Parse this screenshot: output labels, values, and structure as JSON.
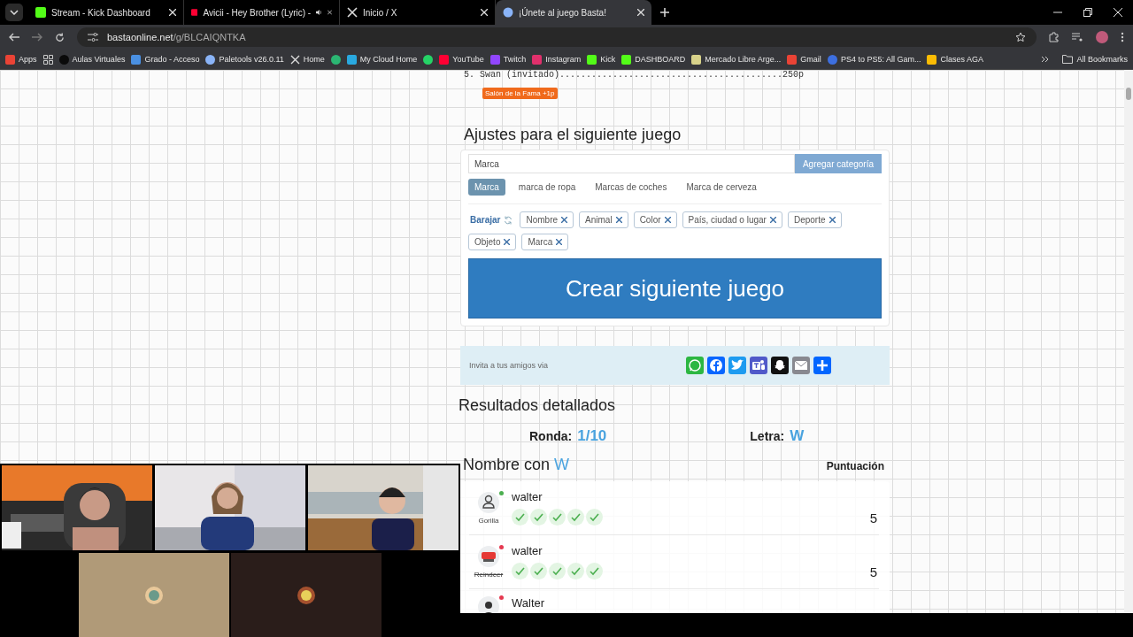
{
  "browser": {
    "tabs": [
      {
        "title": "Stream - Kick Dashboard",
        "kind": "kick",
        "selected": false,
        "audio": false
      },
      {
        "title": "Avicii - Hey Brother (Lyric) -",
        "kind": "youtube",
        "selected": false,
        "audio": true
      },
      {
        "title": "Inicio / X",
        "kind": "x",
        "selected": false,
        "audio": false
      },
      {
        "title": "¡Únete al juego Basta!",
        "kind": "globe",
        "selected": true,
        "audio": false
      }
    ],
    "url_host": "bastaonline.net",
    "url_path": "/g/BLCAIQNTKA",
    "bookmarks": [
      {
        "label": "Apps",
        "kind": "apps"
      },
      {
        "kind": "grid"
      },
      {
        "label": "Aulas Virtuales",
        "kind": "dot"
      },
      {
        "label": "Grado - Acceso",
        "kind": "doc"
      },
      {
        "label": "Paletools v26.0.11",
        "kind": "globe"
      },
      {
        "label": "Home",
        "kind": "x"
      },
      {
        "kind": "green"
      },
      {
        "label": "My Cloud Home",
        "kind": "cloud"
      },
      {
        "kind": "whatsapp"
      },
      {
        "label": "YouTube",
        "kind": "youtube"
      },
      {
        "label": "Twitch",
        "kind": "twitch"
      },
      {
        "label": "Instagram",
        "kind": "instagram"
      },
      {
        "label": "Kick",
        "kind": "kick"
      },
      {
        "label": "DASHBOARD",
        "kind": "kick"
      },
      {
        "label": "Mercado Libre Arge...",
        "kind": "mercado"
      },
      {
        "label": "Gmail",
        "kind": "gmail"
      },
      {
        "label": "PS4 to PS5: All Gam...",
        "kind": "ps"
      },
      {
        "label": "Clases AGA",
        "kind": "drive"
      }
    ],
    "all_bookmarks": "All Bookmarks"
  },
  "ranking_line": "5. Swan (invitado)..........................................250p",
  "badge": "Salón de la Fama +1p",
  "settings": {
    "title": "Ajustes para el siguiente juego",
    "input_value": "Marca",
    "add_button": "Agregar categoría",
    "suggestions": [
      {
        "label": "Marca",
        "selected": true
      },
      {
        "label": "marca de ropa",
        "selected": false
      },
      {
        "label": "Marcas de coches",
        "selected": false
      },
      {
        "label": "Marca de cerveza",
        "selected": false
      }
    ],
    "shuffle": "Barajar",
    "categories": [
      "Nombre",
      "Animal",
      "Color",
      "País, ciudad o lugar",
      "Deporte",
      "Objeto",
      "Marca"
    ],
    "create_button": "Crear siguiente juego"
  },
  "share": {
    "text": "Invita a tus amigos via",
    "services": [
      {
        "kind": "whatsapp",
        "color": "#2cb742"
      },
      {
        "kind": "facebook",
        "color": "#0866ff"
      },
      {
        "kind": "twitter",
        "color": "#1d9bf0"
      },
      {
        "kind": "teams",
        "color": "#5059c9"
      },
      {
        "kind": "snapchat",
        "color": "#111111"
      },
      {
        "kind": "email",
        "color": "#888990"
      },
      {
        "kind": "share",
        "color": "#0166ff"
      }
    ]
  },
  "results": {
    "title": "Resultados detallados",
    "round_label": "Ronda:",
    "round": "1/10",
    "letter_label": "Letra:",
    "letter": "W",
    "category": "Nombre con",
    "category_letter": "W",
    "score_header": "Puntuación",
    "rows": [
      {
        "answer": "walter",
        "player": "Gorilla",
        "kind": "person",
        "color": "#4caf50",
        "eliminated": false,
        "checks": [
          true,
          true,
          true,
          true,
          true
        ],
        "score": "5"
      },
      {
        "answer": "walter",
        "player": "Reindeer",
        "kind": "stop",
        "color": "#e53950",
        "eliminated": true,
        "checks": [
          true,
          true,
          true,
          true,
          true
        ],
        "score": "5"
      },
      {
        "answer": "Walter",
        "kind": "person-dark",
        "color": "#e53950"
      }
    ]
  }
}
